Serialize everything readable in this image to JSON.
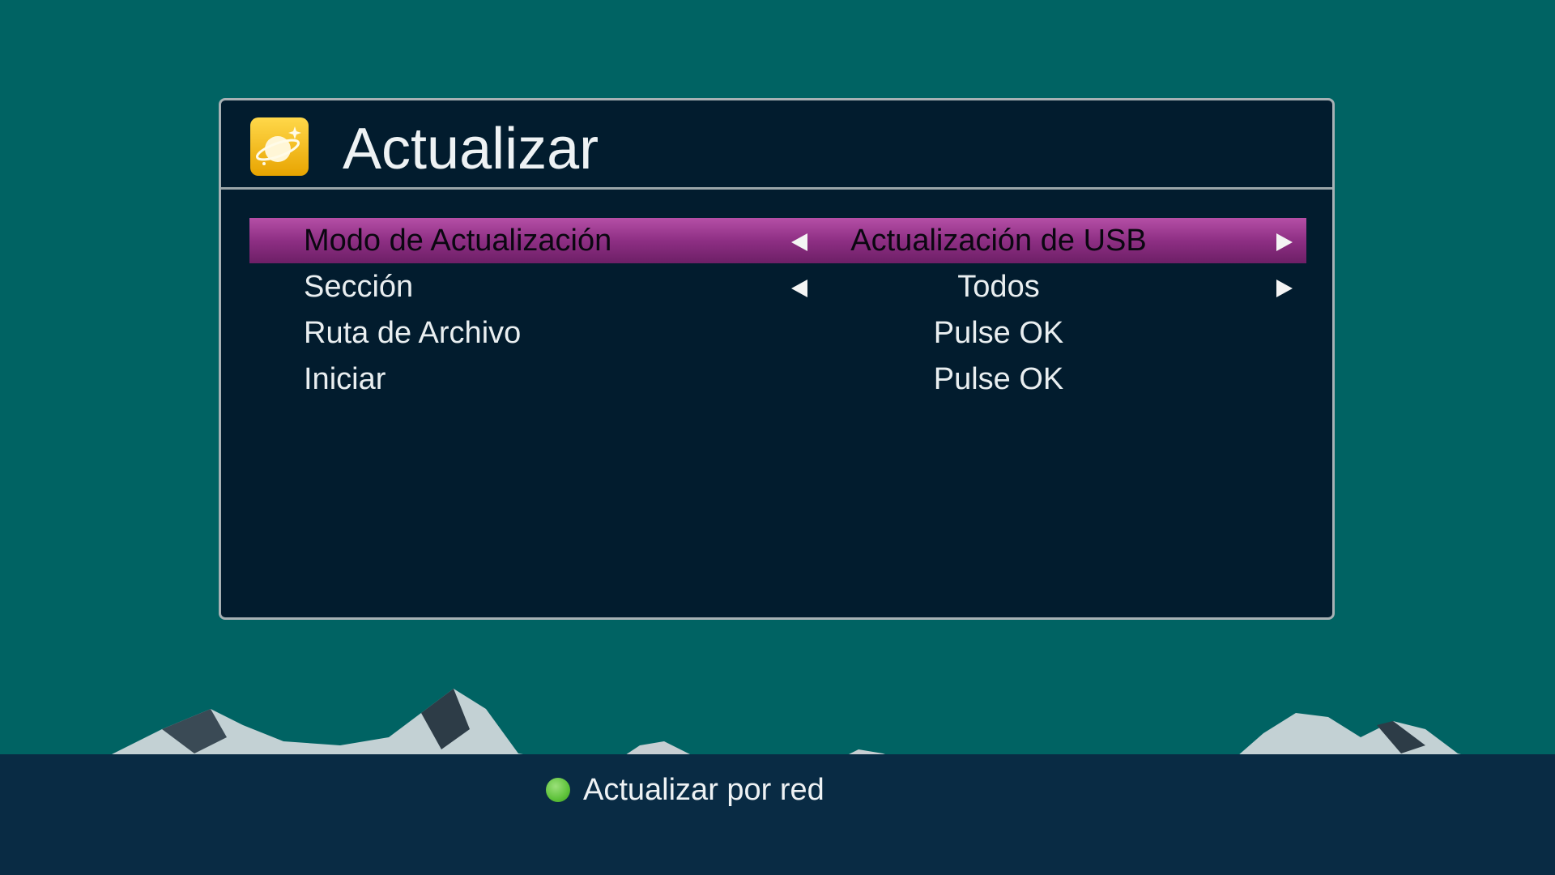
{
  "screen": {
    "title": "Actualizar",
    "icon": "planet-icon"
  },
  "menu": {
    "items": [
      {
        "label": "Modo de Actualización",
        "value": "Actualización de USB",
        "selected": true,
        "has_arrows": true
      },
      {
        "label": "Sección",
        "value": "Todos",
        "selected": false,
        "has_arrows": true
      },
      {
        "label": "Ruta de Archivo",
        "value": "Pulse OK",
        "selected": false,
        "has_arrows": false
      },
      {
        "label": "Iniciar",
        "value": "Pulse OK",
        "selected": false,
        "has_arrows": false
      }
    ]
  },
  "footer": {
    "hint_color": "green",
    "hint_label": "Actualizar por red"
  },
  "colors": {
    "background": "#006363",
    "panel": "#021c2e",
    "selection": "#9b3c92",
    "footer": "#092b44",
    "hint_green": "#5ec23a"
  }
}
